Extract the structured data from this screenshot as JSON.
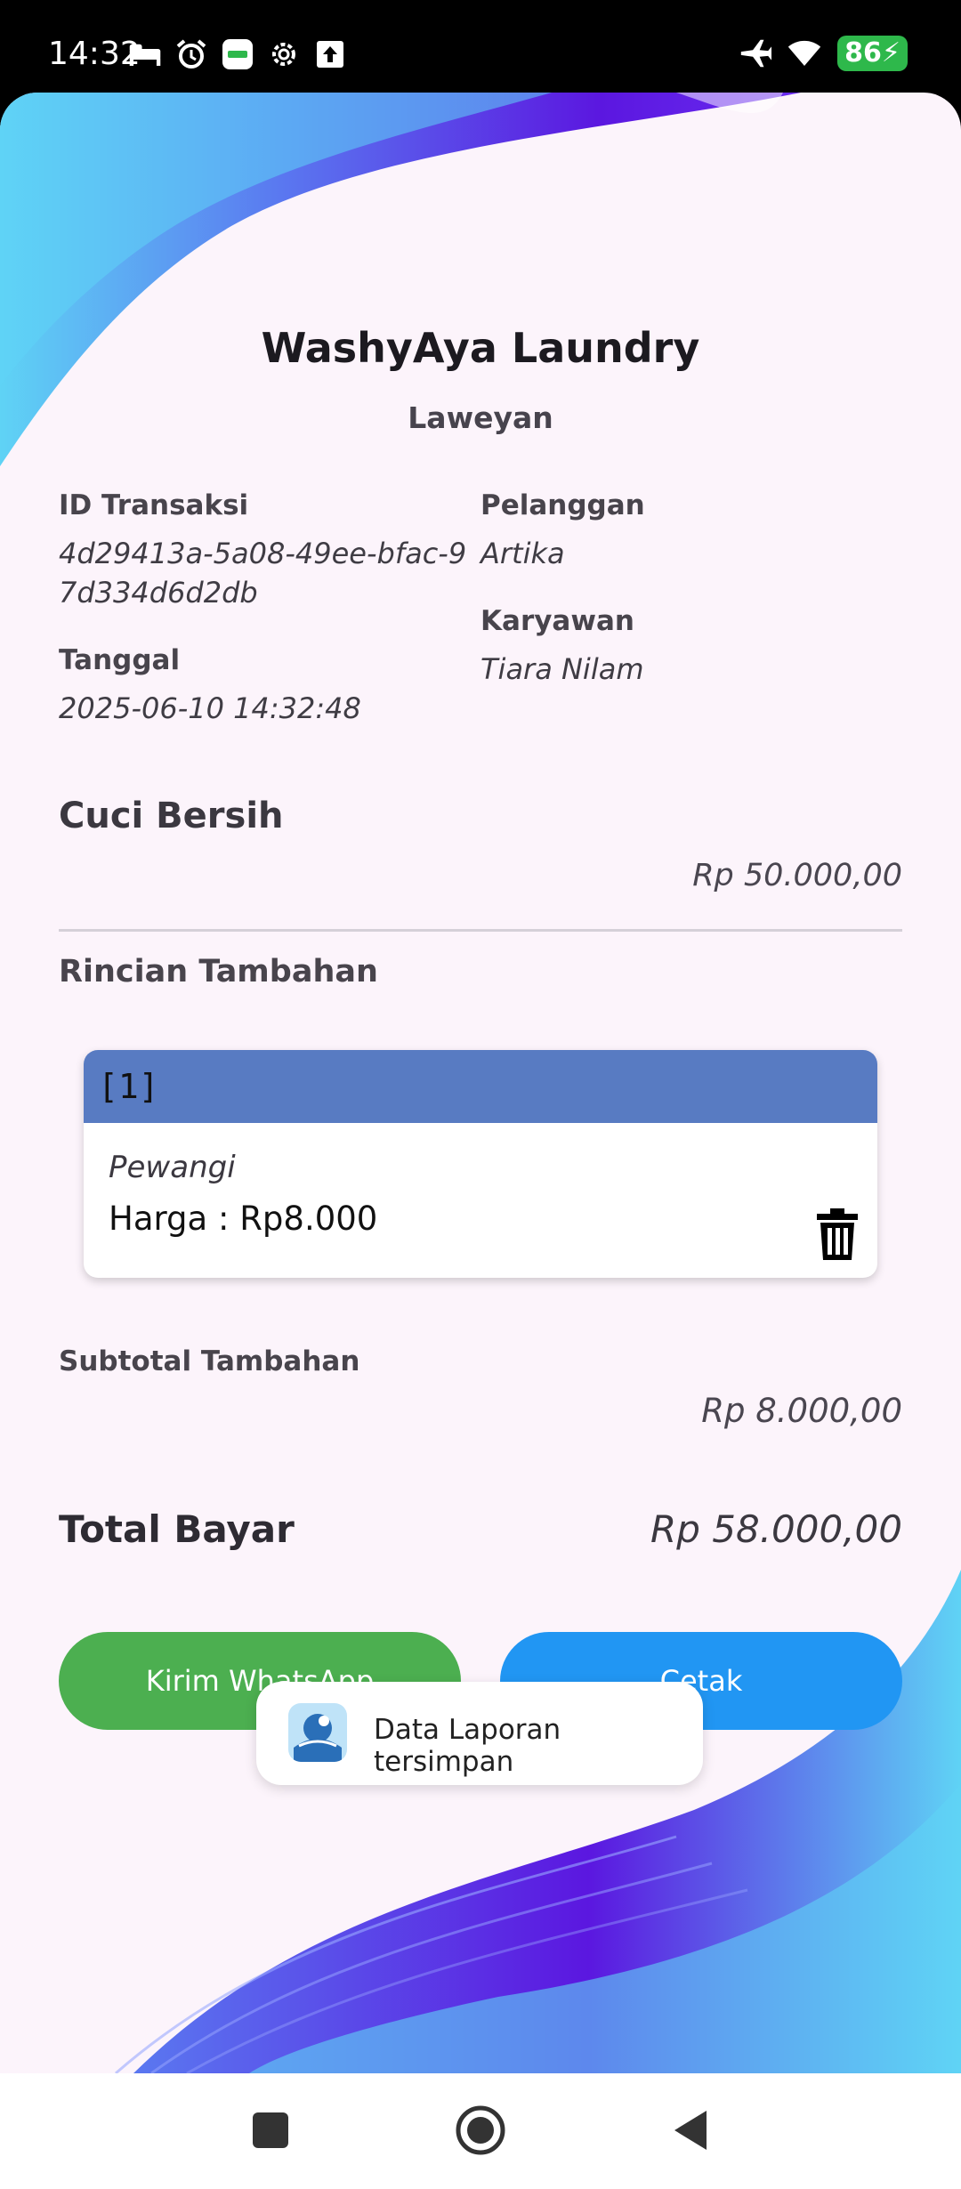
{
  "status_bar": {
    "time": "14:32",
    "battery": "86",
    "left_icons": [
      "bed-icon",
      "alarm-icon",
      "grab-icon",
      "settings-icon",
      "upload-icon"
    ],
    "right_icons": [
      "airplane-icon",
      "wifi-icon",
      "battery-icon"
    ]
  },
  "header": {
    "title": "WashyAya Laundry",
    "subtitle": "Laweyan"
  },
  "transaction": {
    "id_label": "ID Transaksi",
    "id_line1": "4d29413a-5a08-49ee-bfac-9",
    "id_line2": "7d334d6d2db",
    "date_label": "Tanggal",
    "date_value": "2025-06-10 14:32:48",
    "customer_label": "Pelanggan",
    "customer_value": "Artika",
    "employee_label": "Karyawan",
    "employee_value": "Tiara Nilam"
  },
  "service": {
    "name": "Cuci Bersih",
    "price": "Rp 50.000,00"
  },
  "extras": {
    "section_title": "Rincian Tambahan",
    "items": [
      {
        "index": "[1]",
        "name": "Pewangi",
        "price": "Harga : Rp8.000"
      }
    ],
    "subtotal_label": "Subtotal Tambahan",
    "subtotal_value": "Rp 8.000,00"
  },
  "total": {
    "label": "Total Bayar",
    "value": "Rp 58.000,00"
  },
  "actions": {
    "whatsapp_label": "Kirim WhatsApp",
    "print_label": "Cetak"
  },
  "toast": {
    "message": "Data Laporan tersimpan"
  },
  "colors": {
    "whatsapp_button": "#4caf50",
    "print_button": "#2196f3",
    "card_header": "#587bc2",
    "background": "#fcf4fb",
    "wave_purple": "#5b17e0",
    "wave_cyan": "#5fd3f5"
  }
}
